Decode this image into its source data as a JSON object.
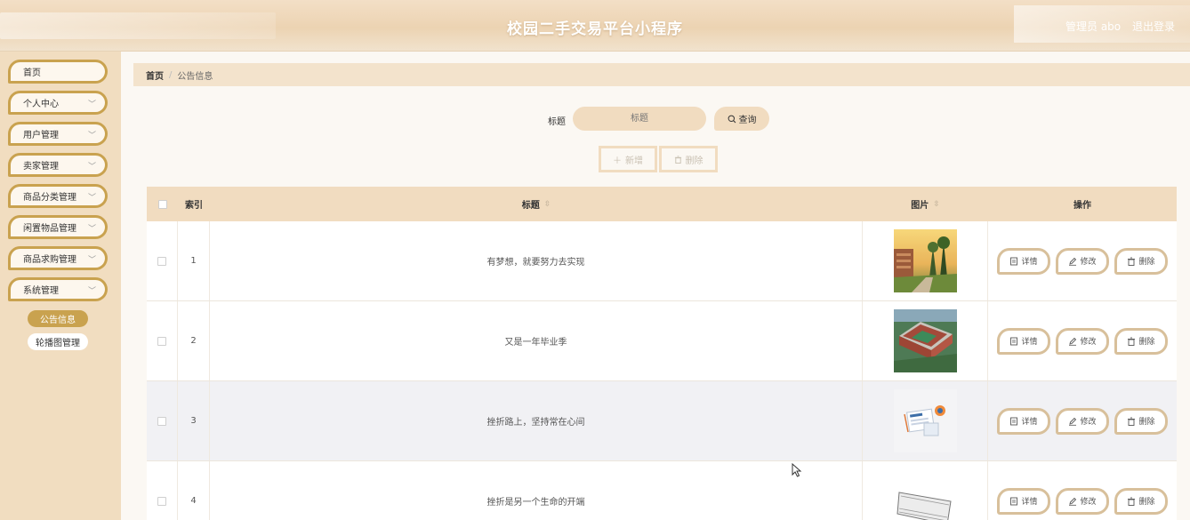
{
  "header": {
    "title": "校园二手交易平台小程序",
    "user": "管理员 abo",
    "logout": "退出登录"
  },
  "sidebar": {
    "items": [
      {
        "label": "首页",
        "has_chevron": false
      },
      {
        "label": "个人中心",
        "has_chevron": true
      },
      {
        "label": "用户管理",
        "has_chevron": true
      },
      {
        "label": "卖家管理",
        "has_chevron": true
      },
      {
        "label": "商品分类管理",
        "has_chevron": true
      },
      {
        "label": "闲置物品管理",
        "has_chevron": true
      },
      {
        "label": "商品求购管理",
        "has_chevron": true
      },
      {
        "label": "系统管理",
        "has_chevron": true
      }
    ],
    "sub_items": [
      {
        "label": "公告信息",
        "active": true
      },
      {
        "label": "轮播图管理",
        "active": false
      }
    ]
  },
  "breadcrumb": {
    "home": "首页",
    "separator": "/",
    "current": "公告信息"
  },
  "search": {
    "label": "标题",
    "placeholder": "标题",
    "button": "查询"
  },
  "actions": {
    "add": "新增",
    "delete": "删除"
  },
  "table": {
    "headers": {
      "index": "索引",
      "title": "标题",
      "image": "图片",
      "ops": "操作"
    },
    "rows": [
      {
        "index": "1",
        "title": "有梦想，就要努力去实现",
        "image": "campus-sunset-photo"
      },
      {
        "index": "2",
        "title": "又是一年毕业季",
        "image": "campus-aerial-photo"
      },
      {
        "index": "3",
        "title": "挫折路上，坚持常在心间",
        "image": "news-illustration"
      },
      {
        "index": "4",
        "title": "挫折是另一个生命的开端",
        "image": "news-paper-illustration"
      }
    ],
    "row_ops": {
      "detail": "详情",
      "edit": "修改",
      "delete": "删除"
    }
  },
  "colors": {
    "accent": "#c9a24f",
    "header_bg": "#ecd3b2",
    "sidebar_bg": "#f1ddc0",
    "table_head_bg": "#f1dcc0",
    "row_alt": "#f1f1f4"
  }
}
